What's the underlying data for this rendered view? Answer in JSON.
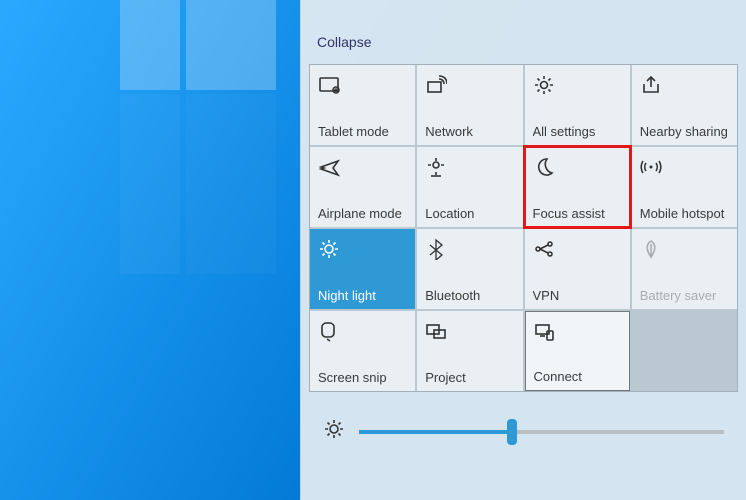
{
  "action_center": {
    "collapse_label": "Collapse",
    "tiles": [
      {
        "id": "tablet-mode",
        "label": "Tablet mode",
        "icon": "tablet-mode-icon",
        "active": false,
        "disabled": false,
        "highlighted": false,
        "selected": false
      },
      {
        "id": "network",
        "label": "Network",
        "icon": "network-icon",
        "active": false,
        "disabled": false,
        "highlighted": false,
        "selected": false
      },
      {
        "id": "all-settings",
        "label": "All settings",
        "icon": "settings-gear-icon",
        "active": false,
        "disabled": false,
        "highlighted": false,
        "selected": false
      },
      {
        "id": "nearby-sharing",
        "label": "Nearby sharing",
        "icon": "share-icon",
        "active": false,
        "disabled": false,
        "highlighted": false,
        "selected": false
      },
      {
        "id": "airplane-mode",
        "label": "Airplane mode",
        "icon": "airplane-icon",
        "active": false,
        "disabled": false,
        "highlighted": false,
        "selected": false
      },
      {
        "id": "location",
        "label": "Location",
        "icon": "location-pin-icon",
        "active": false,
        "disabled": false,
        "highlighted": false,
        "selected": false
      },
      {
        "id": "focus-assist",
        "label": "Focus assist",
        "icon": "moon-icon",
        "active": false,
        "disabled": false,
        "highlighted": true,
        "selected": false
      },
      {
        "id": "mobile-hotspot",
        "label": "Mobile hotspot",
        "icon": "hotspot-icon",
        "active": false,
        "disabled": false,
        "highlighted": false,
        "selected": false
      },
      {
        "id": "night-light",
        "label": "Night light",
        "icon": "brightness-icon",
        "active": true,
        "disabled": false,
        "highlighted": false,
        "selected": false
      },
      {
        "id": "bluetooth",
        "label": "Bluetooth",
        "icon": "bluetooth-icon",
        "active": false,
        "disabled": false,
        "highlighted": false,
        "selected": false
      },
      {
        "id": "vpn",
        "label": "VPN",
        "icon": "vpn-icon",
        "active": false,
        "disabled": false,
        "highlighted": false,
        "selected": false
      },
      {
        "id": "battery-saver",
        "label": "Battery saver",
        "icon": "leaf-icon",
        "active": false,
        "disabled": true,
        "highlighted": false,
        "selected": false
      },
      {
        "id": "screen-snip",
        "label": "Screen snip",
        "icon": "snip-icon",
        "active": false,
        "disabled": false,
        "highlighted": false,
        "selected": false
      },
      {
        "id": "project",
        "label": "Project",
        "icon": "project-icon",
        "active": false,
        "disabled": false,
        "highlighted": false,
        "selected": false
      },
      {
        "id": "connect",
        "label": "Connect",
        "icon": "connect-icon",
        "active": false,
        "disabled": false,
        "highlighted": false,
        "selected": true
      }
    ],
    "brightness": {
      "value_percent": 42
    }
  },
  "colors": {
    "accent": "#2f99d6",
    "highlight_border": "#e11919",
    "panel_bg": "#e9eff3"
  }
}
